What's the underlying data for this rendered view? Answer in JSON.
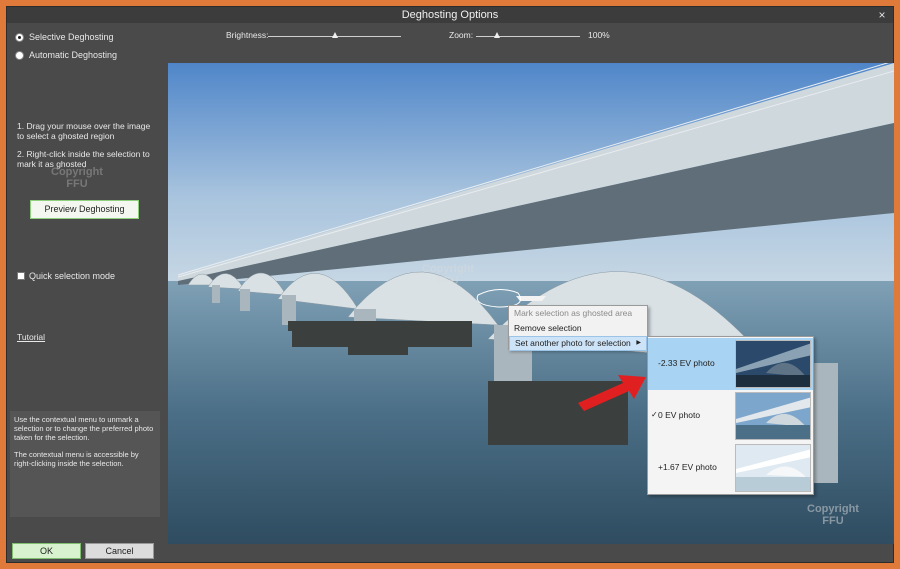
{
  "window": {
    "title": "Deghosting Options",
    "close_label": "×"
  },
  "mode": {
    "selective_label": "Selective Deghosting",
    "automatic_label": "Automatic Deghosting",
    "selected": "selective"
  },
  "instructions": {
    "step1": "1. Drag your mouse over the image to select a ghosted region",
    "step2": "2. Right-click inside the selection to mark it as ghosted"
  },
  "watermark": {
    "line1": "Copyright",
    "line2": "FFU"
  },
  "preview_button": "Preview Deghosting",
  "quick_selection_label": "Quick selection mode",
  "quick_selection_checked": false,
  "tutorial_link": "Tutorial",
  "info": {
    "p1": "Use the contextual menu to unmark a selection or to change the preferred photo taken for the selection.",
    "p2": "The contextual menu is accessible by right-clicking inside the selection."
  },
  "buttons": {
    "ok": "OK",
    "cancel": "Cancel"
  },
  "brightness": {
    "label": "Brightness:",
    "value": 0.5
  },
  "zoom": {
    "label": "Zoom:",
    "value_text": "100%",
    "value": 0.2
  },
  "context_menu": {
    "items": [
      {
        "label": "Mark selection as ghosted area",
        "enabled": false
      },
      {
        "label": "Remove selection",
        "enabled": true
      },
      {
        "label": "Set another photo for selection",
        "enabled": true,
        "submenu": true
      }
    ]
  },
  "photo_submenu": {
    "items": [
      {
        "label": "-2.33 EV photo",
        "checked": false,
        "highlighted": true
      },
      {
        "label": "0 EV photo",
        "checked": true,
        "highlighted": false
      },
      {
        "label": "+1.67 EV photo",
        "checked": false,
        "highlighted": false
      }
    ],
    "check_mark": "✓"
  },
  "colors": {
    "window_bg": "#4a4a4a",
    "frame_border": "#e07a3a",
    "accent_green": "#8fd07f",
    "menu_highlight": "#a9d3f2",
    "arrow_red": "#e02020"
  }
}
